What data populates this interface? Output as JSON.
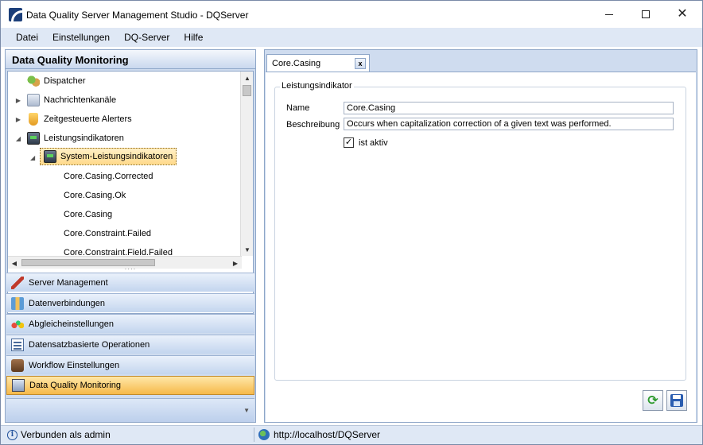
{
  "window": {
    "title": "Data Quality Server Management Studio - DQServer"
  },
  "menu": [
    "Datei",
    "Einstellungen",
    "DQ-Server",
    "Hilfe"
  ],
  "left_panel": {
    "title": "Data Quality Monitoring",
    "tree": [
      {
        "label": "Dispatcher",
        "icon": "dispatcher-icon",
        "level": 0,
        "toggle": ""
      },
      {
        "label": "Nachrichtenkanäle",
        "icon": "channels-icon",
        "level": 0,
        "toggle": "collapsed"
      },
      {
        "label": "Zeitgesteuerte Alerters",
        "icon": "alerters-icon",
        "level": 0,
        "toggle": "collapsed"
      },
      {
        "label": "Leistungsindikatoren",
        "icon": "performance-indicator-icon",
        "level": 0,
        "toggle": "expanded"
      },
      {
        "label": "System-Leistungsindikatoren",
        "icon": "performance-indicator-icon",
        "level": 1,
        "toggle": "expanded",
        "selected": true
      },
      {
        "label": "Core.Casing.Corrected",
        "level": 2
      },
      {
        "label": "Core.Casing.Ok",
        "level": 2
      },
      {
        "label": "Core.Casing",
        "level": 2
      },
      {
        "label": "Core.Constraint.Failed",
        "level": 2
      },
      {
        "label": "Core.Constraint.Field.Failed",
        "level": 2
      }
    ],
    "nav": [
      {
        "label": "Server Management",
        "icon": "wrench-icon"
      },
      {
        "label": "Datenverbindungen",
        "icon": "database-icon"
      },
      {
        "label": "Abgleicheinstellungen",
        "icon": "matching-icon"
      },
      {
        "label": "Datensatzbasierte Operationen",
        "icon": "records-icon"
      },
      {
        "label": "Workflow Einstellungen",
        "icon": "workflow-icon"
      },
      {
        "label": "Data Quality Monitoring",
        "icon": "monitoring-icon",
        "active": true
      }
    ]
  },
  "tab": {
    "label": "Core.Casing",
    "close_label": "x"
  },
  "form": {
    "group_title": "Leistungsindikator",
    "name_label": "Name",
    "name_value": "Core.Casing",
    "description_label": "Beschreibung",
    "description_value": "Occurs when capitalization correction of a given text was performed.",
    "active_label": "ist aktiv",
    "active_checked": true
  },
  "statusbar": {
    "left": "Verbunden als admin",
    "right": "http://localhost/DQServer"
  },
  "colors": {
    "accent": "#f6b94a",
    "panel": "#cfdcef",
    "menubar": "#dfe8f5"
  }
}
